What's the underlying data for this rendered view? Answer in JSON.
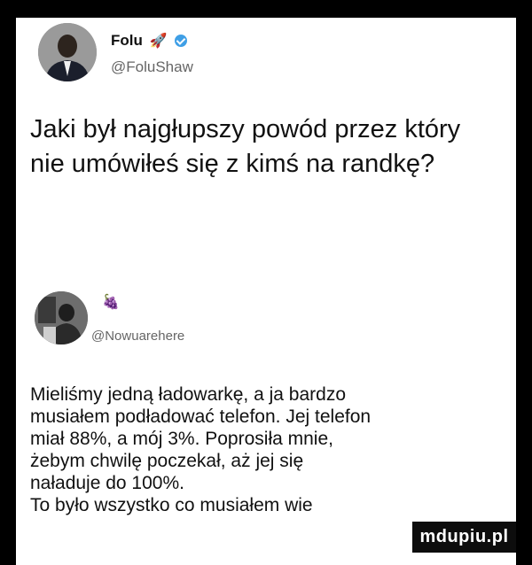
{
  "post1": {
    "name": "Folu",
    "handle": "@FoluShaw",
    "text": "Jaki był najgłupszy powód przez który nie umówiłeś się z kimś na randkę?"
  },
  "post2": {
    "handle": "@Nowuarehere",
    "lines": [
      "Mieliśmy jedną ładowarkę, a ja bardzo",
      "musiałem podładować telefon. Jej telefon",
      "miał 88%, a mój 3%. Poprosiła mnie,",
      "żebym chwilę poczekał, aż jej się",
      "naładuje do 100%.",
      "To było wszystko co musiałem wie"
    ]
  },
  "watermark": "mdupiu.pl",
  "colors": {
    "verified": "#3f9fe6",
    "text": "#111111",
    "muted": "#666666"
  }
}
